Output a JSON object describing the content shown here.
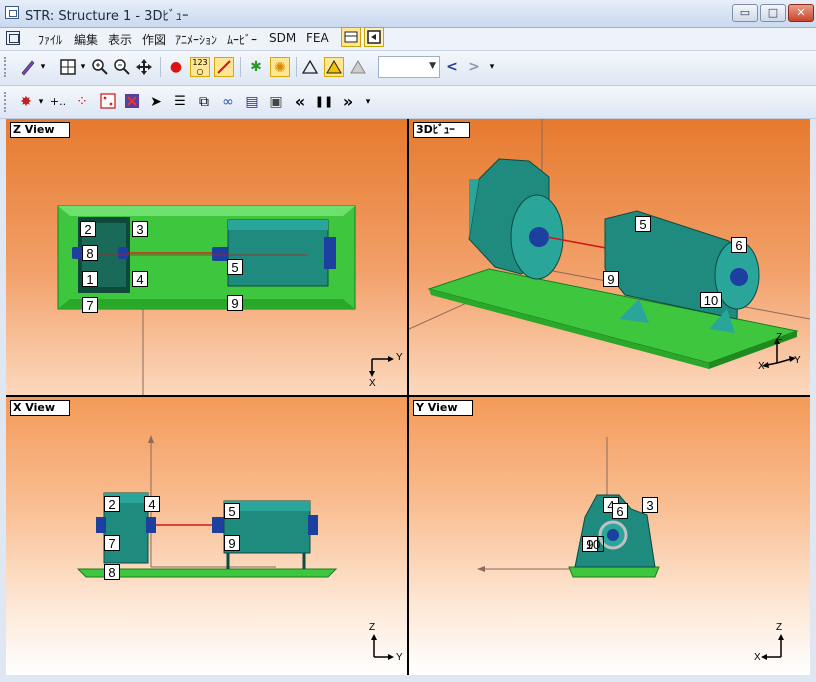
{
  "window": {
    "title": "STR: Structure 1 - 3Dﾋﾞｭｰ",
    "minimize": "▭",
    "maximize": "□",
    "close": "✕"
  },
  "menu": {
    "items": [
      "ﾌｧｲﾙ",
      "編集",
      "表示",
      "作図",
      "ｱﾆﾒｰｼｮﾝ",
      "ﾑｰﾋﾞｰ",
      "SDM",
      "FEA"
    ]
  },
  "toolbar1": {
    "nav_prev": "<",
    "nav_next": ">",
    "combo_value": ""
  },
  "toolbar2": {
    "rewind": "«",
    "pause": "❚❚",
    "forward": "»"
  },
  "views": {
    "z": {
      "label": "Z View",
      "axis_h": "Y",
      "axis_v": "X"
    },
    "threed": {
      "label": "3Dﾋﾞｭｰ",
      "axis_h": "Y",
      "axis_v": "Z",
      "axis_o": "X"
    },
    "x": {
      "label": "X View",
      "axis_h": "Y",
      "axis_v": "Z"
    },
    "y": {
      "label": "Y View",
      "axis_h": "X",
      "axis_v": "Z"
    }
  },
  "points": {
    "z": [
      "2",
      "3",
      "8",
      "1",
      "4",
      "7",
      "5",
      "9"
    ],
    "threed": [
      "5",
      "6",
      "9",
      "10"
    ],
    "x": [
      "2",
      "4",
      "5",
      "7",
      "9",
      "8"
    ],
    "y": [
      "4",
      "6",
      "3",
      "9",
      "10"
    ]
  }
}
